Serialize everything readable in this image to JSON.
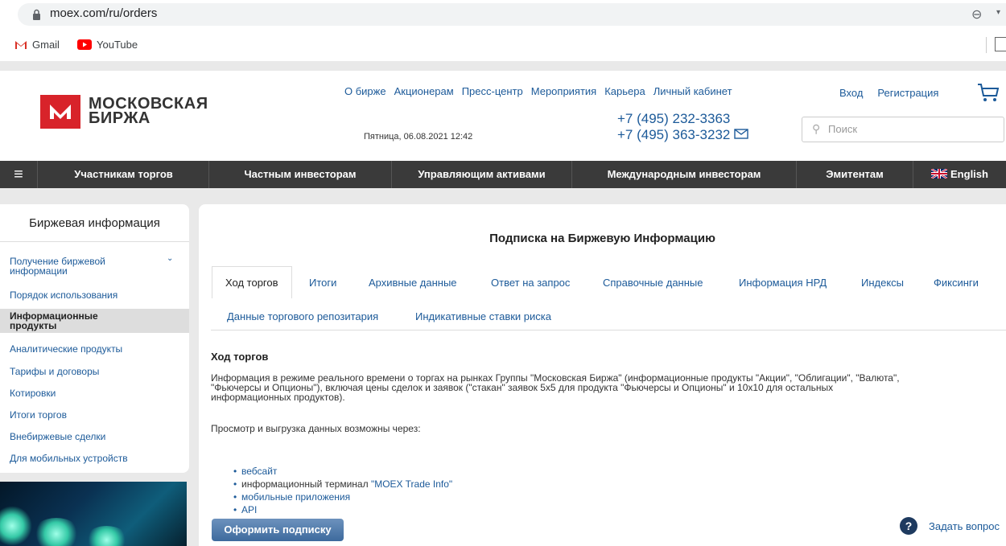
{
  "browser": {
    "url": "moex.com/ru/orders",
    "bookmarks": [
      {
        "label": "Gmail",
        "icon": "gmail-icon"
      },
      {
        "label": "YouTube",
        "icon": "youtube-icon"
      }
    ]
  },
  "header": {
    "logo_line1": "МОСКОВСКАЯ",
    "logo_line2": "БИРЖА",
    "top_nav": [
      "О бирже",
      "Акционерам",
      "Пресс-центр",
      "Мероприятия",
      "Карьера",
      "Личный кабинет"
    ],
    "login": "Вход",
    "register": "Регистрация",
    "phone1": "+7 (495) 232-3363",
    "phone2": "+7 (495) 363-3232",
    "date": "Пятница, 06.08.2021 12:42",
    "search_placeholder": "Поиск"
  },
  "main_menu": [
    "Участникам торгов",
    "Частным инвесторам",
    "Управляющим активами",
    "Международным инвесторам",
    "Эмитентам",
    "English"
  ],
  "sidebar": {
    "title": "Биржевая информация",
    "items": [
      "Получение биржевой информации",
      "Порядок использования",
      "Информационные продукты",
      "Аналитические продукты",
      "Тарифы и договоры",
      "Котировки",
      "Итоги торгов",
      "Внебиржевые сделки",
      "Для мобильных устройств"
    ]
  },
  "main": {
    "title": "Подписка на Биржевую Информацию",
    "tabs": [
      "Ход торгов",
      "Итоги",
      "Архивные данные",
      "Ответ на запрос",
      "Справочные данные",
      "Информация НРД",
      "Индексы",
      "Фиксинги"
    ],
    "tabs_row2": [
      "Данные торгового репозитария",
      "Индикативные ставки риска"
    ],
    "section_title": "Ход торгов",
    "para1_line1": "Информация в режиме реального времени о торгах на рынках Группы \"Московская Биржа\" (информационные продукты \"Акции\", \"Облигации\", \"Валюта\",",
    "para1_line2": "\"Фьючерсы и Опционы\"), включая цены сделок и заявок (\"стакан\" заявок 5х5 для продукта \"Фьючерсы и Опционы\" и 10х10 для остальных",
    "para1_line3": "информационных продуктов).",
    "para2": "Просмотр и выгрузка данных возможны через:",
    "bullet1": "вебсайт",
    "bullet2_prefix": "информационный терминал ",
    "bullet2_link": "\"MOEX Trade Info\"",
    "bullet3": "мобильные приложения",
    "bullet4": "API",
    "subscribe_button": "Оформить подписку",
    "ask_question": "Задать вопрос"
  },
  "colors": {
    "brand_red": "#d8232a",
    "link": "#1c5a99",
    "menu_bg": "#3a3a3a"
  }
}
